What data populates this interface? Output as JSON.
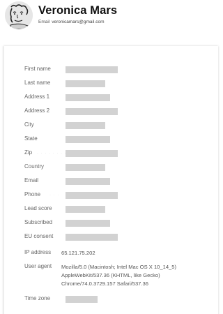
{
  "profile": {
    "name": "Veronica Mars",
    "email_label": "Email",
    "email": "veronicamars@gmail.com",
    "avatar_icon": "avatar-icon"
  },
  "details": {
    "first_name": "First name",
    "last_name": "Last name",
    "address1": "Address 1",
    "address2": "Address 2",
    "city": "City",
    "state": "State",
    "zip": "Zip",
    "country": "Country",
    "email": "Email",
    "phone": "Phone",
    "lead_score": "Lead score",
    "subscribed": "Subscribed",
    "eu_consent": "EU consent",
    "ip_address_label": "IP address",
    "ip_address_value": "65.121.75.202",
    "user_agent_label": "User agent",
    "user_agent_line1": "Mozilla/5.0 (Macintosh; Intel Mac OS X 10_14_5)",
    "user_agent_line2": "AppleWebKit/537.36 (KHTML, like Gecko)",
    "user_agent_line3": "Chrome/74.0.3729.157 Safari/537.36",
    "time_zone": "Time zone"
  },
  "colors": {
    "placeholder_bar": "#d2d2d2",
    "name_text": "#111111"
  }
}
